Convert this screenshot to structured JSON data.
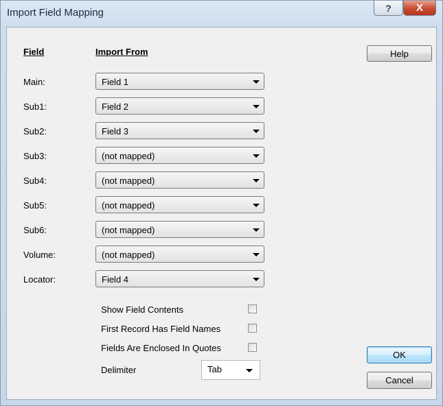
{
  "window": {
    "title": "Import Field Mapping",
    "help_glyph": "?",
    "close_glyph": "X"
  },
  "headers": {
    "field": "Field",
    "import_from": "Import From"
  },
  "fields": [
    {
      "label": "Main:",
      "value": "Field 1"
    },
    {
      "label": "Sub1:",
      "value": "Field 2"
    },
    {
      "label": "Sub2:",
      "value": "Field 3"
    },
    {
      "label": "Sub3:",
      "value": "(not mapped)"
    },
    {
      "label": "Sub4:",
      "value": "(not mapped)"
    },
    {
      "label": "Sub5:",
      "value": "(not mapped)"
    },
    {
      "label": "Sub6:",
      "value": "(not mapped)"
    },
    {
      "label": "Volume:",
      "value": "(not mapped)"
    },
    {
      "label": "Locator:",
      "value": "Field 4"
    }
  ],
  "options": {
    "show_field_contents": {
      "label": "Show Field Contents",
      "checked": false
    },
    "first_record_has_field_names": {
      "label": "First Record Has Field Names",
      "checked": false
    },
    "fields_enclosed_in_quotes": {
      "label": "Fields Are Enclosed In Quotes",
      "checked": false
    }
  },
  "delimiter": {
    "label": "Delimiter",
    "value": "Tab"
  },
  "buttons": {
    "help": "Help",
    "ok": "OK",
    "cancel": "Cancel"
  }
}
